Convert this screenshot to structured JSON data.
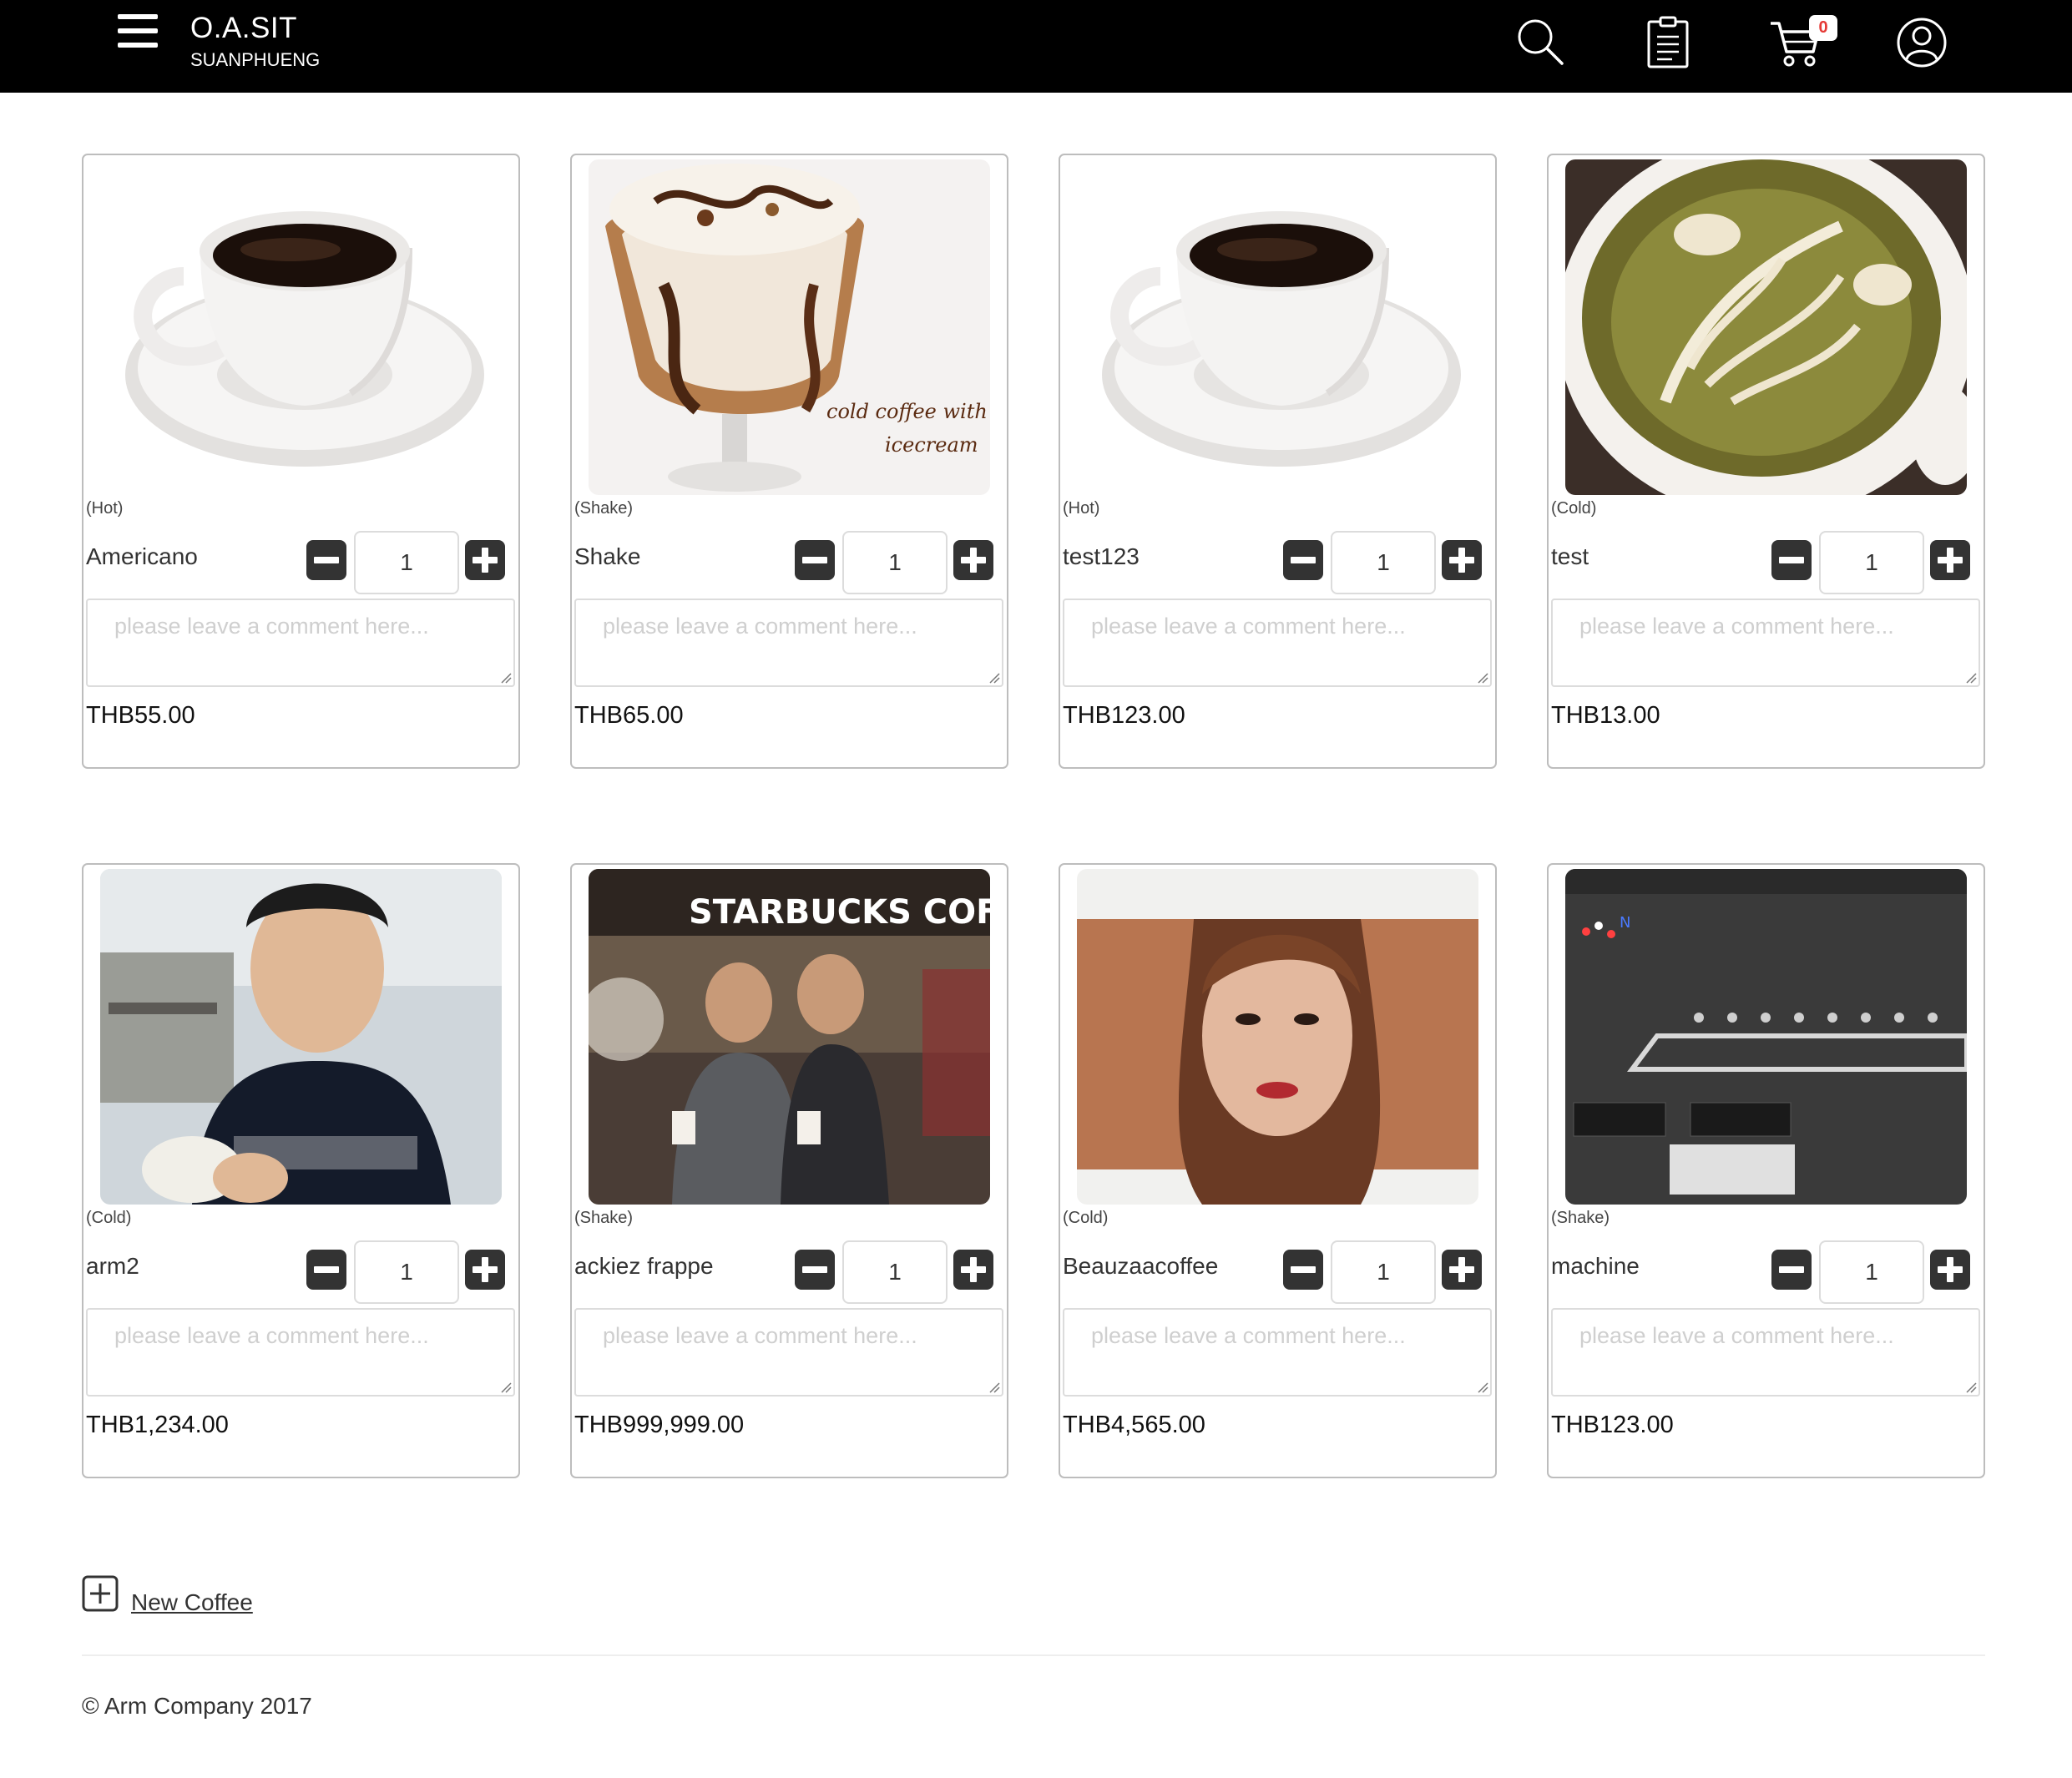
{
  "brand": {
    "title": "O.A.SIT",
    "subtitle": "SUANPHUENG"
  },
  "nav": {
    "icons": [
      "menu-icon",
      "search-icon",
      "clipboard-icon",
      "cart-icon",
      "user-icon"
    ],
    "cart_count": "0",
    "badge_color": "#e53935"
  },
  "products": [
    {
      "category": "(Hot)",
      "name": "Americano",
      "quantity": "1",
      "comment_placeholder": "please leave a comment here...",
      "price": "THB55.00",
      "image": "coffee-cup"
    },
    {
      "category": "(Shake)",
      "name": "Shake",
      "quantity": "1",
      "comment_placeholder": "please leave a comment here...",
      "price": "THB65.00",
      "image": "cold-coffee-icecream",
      "image_caption": [
        "cold coffee with",
        "icecream"
      ]
    },
    {
      "category": "(Hot)",
      "name": "test123",
      "quantity": "1",
      "comment_placeholder": "please leave a comment here...",
      "price": "THB123.00",
      "image": "coffee-cup"
    },
    {
      "category": "(Cold)",
      "name": "test",
      "quantity": "1",
      "comment_placeholder": "please leave a comment here...",
      "price": "THB13.00",
      "image": "latte-art"
    },
    {
      "category": "(Cold)",
      "name": "arm2",
      "quantity": "1",
      "comment_placeholder": "please leave a comment here...",
      "price": "THB1,234.00",
      "image": "man-photo"
    },
    {
      "category": "(Shake)",
      "name": "ackiez frappe",
      "quantity": "1",
      "comment_placeholder": "please leave a comment here...",
      "price": "THB999,999.00",
      "image": "starbucks-photo",
      "image_caption": [
        "STARBUCKS COFF"
      ]
    },
    {
      "category": "(Cold)",
      "name": "Beauzaacoffee",
      "quantity": "1",
      "comment_placeholder": "please leave a comment here...",
      "price": "THB4,565.00",
      "image": "woman-photo"
    },
    {
      "category": "(Shake)",
      "name": "machine",
      "quantity": "1",
      "comment_placeholder": "please leave a comment here...",
      "price": "THB123.00",
      "image": "machine-screenshot"
    }
  ],
  "footer": {
    "new_coffee_label": "New Coffee",
    "copyright": "© Arm Company 2017"
  },
  "colors": {
    "navbar": "#000000",
    "button": "#333333",
    "border": "#bdbdbd"
  }
}
